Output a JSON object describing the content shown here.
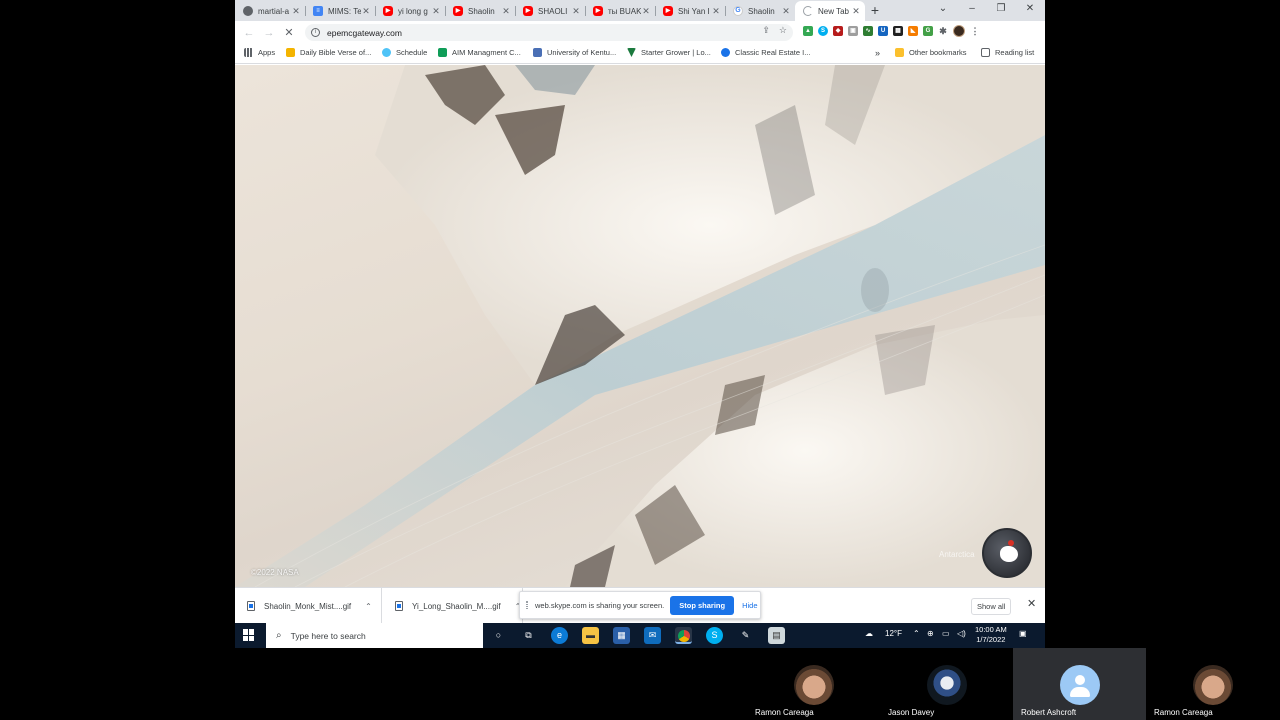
{
  "browser": {
    "tabs": [
      {
        "title": "martial-a",
        "icon": "web-icon",
        "active": false
      },
      {
        "title": "MIMS: Te",
        "icon": "docs-icon",
        "active": false
      },
      {
        "title": "yi long g",
        "icon": "youtube-icon",
        "active": false
      },
      {
        "title": "Shaolin",
        "icon": "youtube-icon",
        "active": false
      },
      {
        "title": "SHAOLI",
        "icon": "youtube-icon",
        "active": false
      },
      {
        "title": "ты BUAK",
        "icon": "youtube-icon",
        "active": false
      },
      {
        "title": "Shi Yan I",
        "icon": "youtube-icon",
        "active": false
      },
      {
        "title": "Shaolin",
        "icon": "google-icon",
        "active": false
      },
      {
        "title": "New Tab",
        "icon": "loading-icon",
        "active": true
      }
    ],
    "url": "epemcgateway.com",
    "bookmarks": [
      {
        "label": "Apps",
        "icon": "apps-grid-icon",
        "color": "#5f6368"
      },
      {
        "label": "Daily Bible Verse of...",
        "icon": "bible-icon",
        "color": "#f4b400"
      },
      {
        "label": "Schedule",
        "icon": "cloud-icon",
        "color": "#4fc3f7"
      },
      {
        "label": "AIM Managment C...",
        "icon": "sheets-icon",
        "color": "#0f9d58"
      },
      {
        "label": "University of Kentu...",
        "icon": "uk-icon",
        "color": "#4a6fb5"
      },
      {
        "label": "Starter Grower | Lo...",
        "icon": "leaf-icon",
        "color": "#1b7a3e"
      },
      {
        "label": "Classic Real Estate I...",
        "icon": "real-estate-icon",
        "color": "#1a73e8"
      }
    ],
    "bookmarks_overflow": "»",
    "other_bookmarks": "Other bookmarks",
    "reading_list": "Reading list"
  },
  "map": {
    "credit": "©2022 NASA",
    "location_label": "Antarctica"
  },
  "downloads": {
    "items": [
      {
        "name": "Shaolin_Monk_Mist....gif"
      },
      {
        "name": "Yi_Long_Shaolin_M....gif"
      }
    ],
    "show_all": "Show all"
  },
  "skype_share": {
    "message": "web.skype.com is sharing your screen.",
    "stop_label": "Stop sharing",
    "hide_label": "Hide"
  },
  "taskbar": {
    "search_placeholder": "Type here to search",
    "temperature": "12°F",
    "time": "10:00 AM",
    "date": "1/7/2022"
  },
  "call": {
    "participants": [
      {
        "name": "Ramon Careaga",
        "avatar": "person-photo"
      },
      {
        "name": "Jason Davey",
        "avatar": "bird-photo"
      },
      {
        "name": "Robert Ashcroft",
        "avatar": "default-avatar"
      },
      {
        "name": "Ramon Careaga",
        "avatar": "person-photo"
      }
    ]
  }
}
